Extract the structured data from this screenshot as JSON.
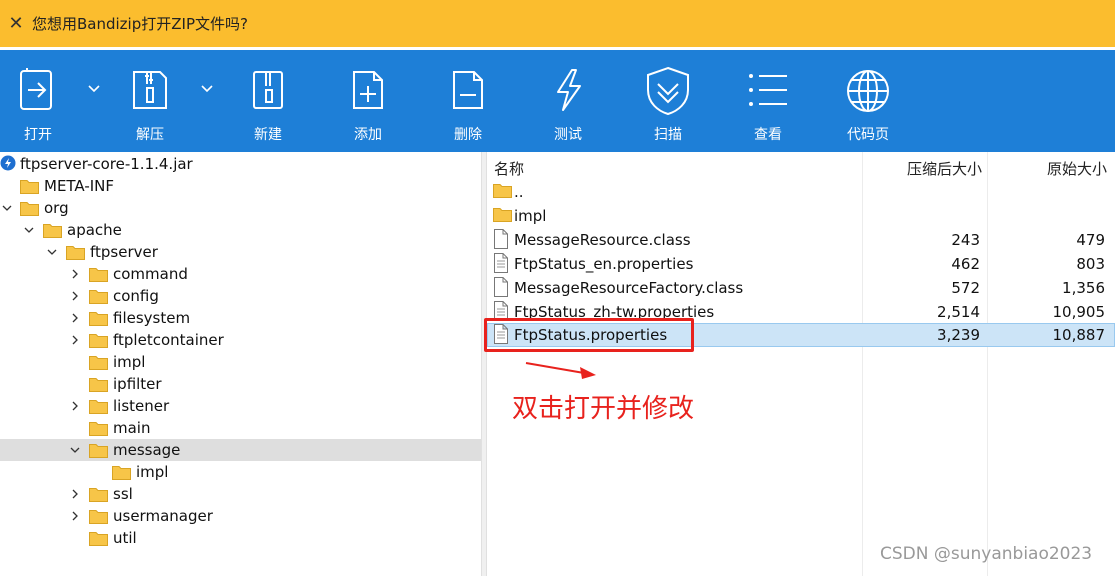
{
  "notification": {
    "close_glyph": "✕",
    "message": "您想用Bandizip打开ZIP文件吗?"
  },
  "toolbar": {
    "open": "打开",
    "extract": "解压",
    "new": "新建",
    "add": "添加",
    "delete": "删除",
    "test": "测试",
    "scan": "扫描",
    "view": "查看",
    "codepage": "代码页"
  },
  "tree": {
    "root": "ftpserver-core-1.1.4.jar",
    "meta_inf": "META-INF",
    "org": "org",
    "apache": "apache",
    "ftpserver": "ftpserver",
    "command": "command",
    "config": "config",
    "filesystem": "filesystem",
    "ftpletcontainer": "ftpletcontainer",
    "impl": "impl",
    "ipfilter": "ipfilter",
    "listener": "listener",
    "main": "main",
    "message": "message",
    "message_impl": "impl",
    "ssl": "ssl",
    "usermanager": "usermanager",
    "util": "util"
  },
  "list": {
    "headers": {
      "name": "名称",
      "compressed": "压缩后大小",
      "original": "原始大小"
    },
    "rows": [
      {
        "name": "..",
        "compressed": "",
        "original": ""
      },
      {
        "name": "impl",
        "compressed": "",
        "original": ""
      },
      {
        "name": "MessageResource.class",
        "compressed": "243",
        "original": "479"
      },
      {
        "name": "FtpStatus_en.properties",
        "compressed": "462",
        "original": "803"
      },
      {
        "name": "MessageResourceFactory.class",
        "compressed": "572",
        "original": "1,356"
      },
      {
        "name": "FtpStatus_zh-tw.properties",
        "compressed": "2,514",
        "original": "10,905"
      },
      {
        "name": "FtpStatus.properties",
        "compressed": "3,239",
        "original": "10,887"
      }
    ]
  },
  "annotation": "双击打开并修改",
  "watermark": "CSDN @sunyanbiao2023",
  "colors": {
    "toolbar": "#1e7fd7",
    "notify": "#fbbd2e",
    "annotation": "#e8221d",
    "folder": "#f7c548"
  }
}
